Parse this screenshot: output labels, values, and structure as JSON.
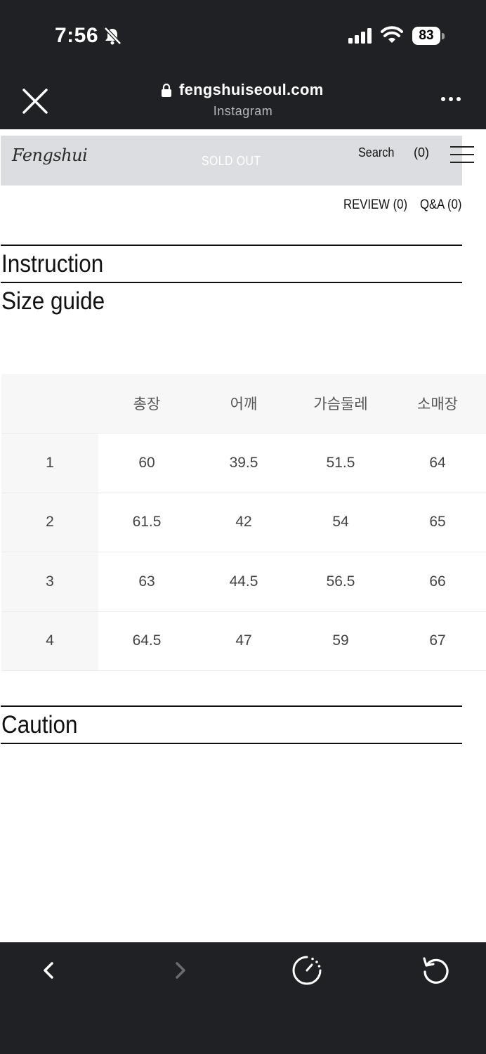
{
  "status_bar": {
    "time": "7:56",
    "battery": "83",
    "icons": [
      "bell-slash-icon",
      "signal-icon",
      "wifi-icon",
      "battery-icon"
    ]
  },
  "browser": {
    "url": "fengshuiseoul.com",
    "source": "Instagram",
    "icons": [
      "close-icon",
      "lock-icon",
      "more-icon"
    ]
  },
  "site_header": {
    "logo": "Fengshui",
    "sold_out": "SOLD OUT",
    "search": "Search",
    "cart_count": "(0)",
    "menu_icon": "hamburger-icon"
  },
  "tabs": {
    "review": "REVIEW (0)",
    "qa": "Q&A (0)"
  },
  "sections": {
    "instruction": "Instruction",
    "size_guide": "Size guide",
    "caution": "Caution"
  },
  "size_table": {
    "headers": [
      "",
      "총장",
      "어깨",
      "가슴둘레",
      "소매장"
    ],
    "rows": [
      [
        "1",
        "60",
        "39.5",
        "51.5",
        "64"
      ],
      [
        "2",
        "61.5",
        "42",
        "54",
        "65"
      ],
      [
        "3",
        "63",
        "44.5",
        "56.5",
        "66"
      ],
      [
        "4",
        "64.5",
        "47",
        "59",
        "67"
      ]
    ]
  },
  "toolbar": {
    "icons": [
      "back-icon",
      "forward-icon",
      "speed-icon",
      "reload-icon"
    ]
  },
  "colors": {
    "chrome_bg": "#202124",
    "header_bg": "#dcdde1",
    "table_header_bg": "#f7f7f7"
  }
}
